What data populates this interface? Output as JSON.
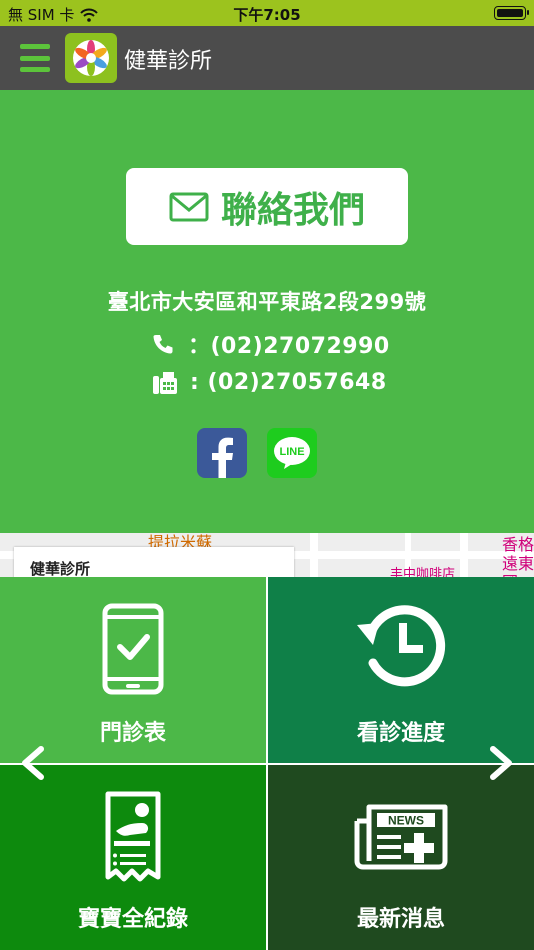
{
  "status_bar": {
    "carrier": "無 SIM 卡",
    "time": "下午7:05"
  },
  "app_bar": {
    "title": "健華診所"
  },
  "contact": {
    "button_label": "聯絡我們",
    "address": "臺北市大安區和平東路2段299號",
    "phone": "：(02)27072990",
    "fax": ": (02)27057648",
    "line_badge": "LINE"
  },
  "map": {
    "place_card": "健華診所",
    "poi_1": "提拉米蘇",
    "poi_2_line1": "香格",
    "poi_2_line2": "遠東國",
    "poi_3": "丰中咖啡店"
  },
  "tiles": [
    {
      "label": "門診表",
      "icon": "phone-check-icon"
    },
    {
      "label": "看診進度",
      "icon": "history-clock-icon"
    },
    {
      "label": "寶寶全紀錄",
      "icon": "baby-record-icon"
    },
    {
      "label": "最新消息",
      "icon": "newspaper-icon"
    }
  ],
  "news_icon_text": "NEWS",
  "colors": {
    "status_bar": "#9cc31e",
    "app_bar": "#4c4c4c",
    "contact_bg": "#4cb848",
    "tile_1": "#4cb848",
    "tile_2": "#0f8048",
    "tile_3": "#0d8a0d",
    "tile_4": "#1f4a1f",
    "facebook": "#3b5999",
    "line": "#1ecc1e"
  }
}
